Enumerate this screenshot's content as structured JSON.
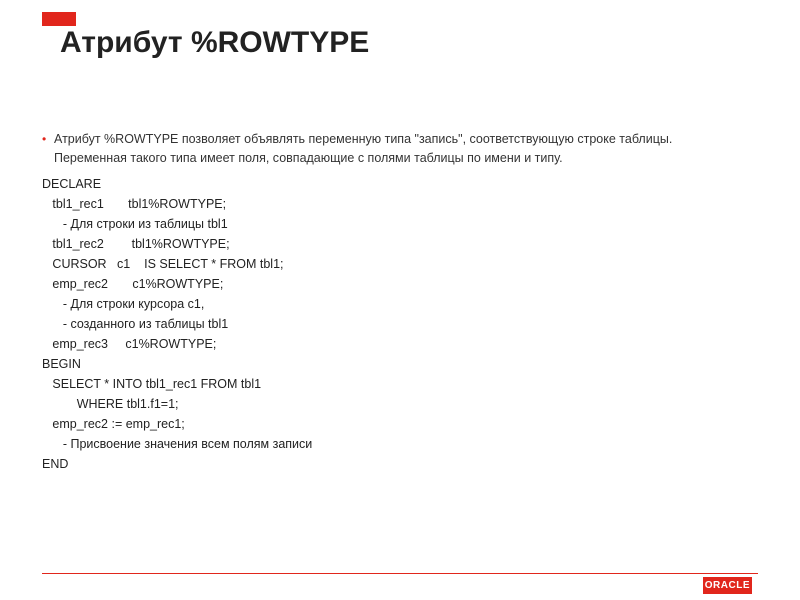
{
  "slide": {
    "title": "Атрибут %ROWTYPE",
    "bullet": "Атрибут %ROWTYPE позволяет объявлять переменную типа \"запись\", соответствующую строке таблицы. Переменная такого типа имеет поля, совпадающие с полями таблицы по имени и типу.",
    "code": "DECLARE\n   tbl1_rec1       tbl1%ROWTYPE;\n      - Для строки из таблицы tbl1\n   tbl1_rec2        tbl1%ROWTYPE;\n   CURSOR   c1    IS SELECT * FROM tbl1;\n   emp_rec2       c1%ROWTYPE;\n      - Для строки курсора c1,\n      - созданного из таблицы tbl1\n   emp_rec3     c1%ROWTYPE;\nBEGIN\n   SELECT * INTO tbl1_rec1 FROM tbl1\n          WHERE tbl1.f1=1;\n   emp_rec2 := emp_rec1;\n      - Присвоение значения всем полям записи\nEND",
    "logo": "ORACLE"
  }
}
